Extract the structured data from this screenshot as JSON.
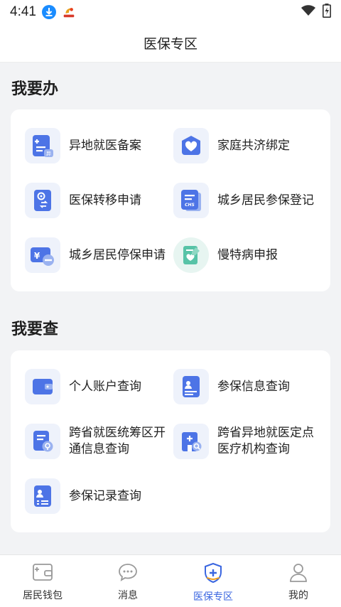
{
  "status_bar": {
    "time": "4:41"
  },
  "header": {
    "title": "医保专区"
  },
  "section_do": {
    "title": "我要办",
    "items": [
      {
        "label": "异地就医备案",
        "icon": "document-remote-icon"
      },
      {
        "label": "家庭共济绑定",
        "icon": "house-heart-icon"
      },
      {
        "label": "医保转移申请",
        "icon": "card-transfer-icon"
      },
      {
        "label": "城乡居民参保登记",
        "icon": "chs-card-icon"
      },
      {
        "label": "城乡居民停保申请",
        "icon": "yuan-minus-icon"
      },
      {
        "label": "慢特病申报",
        "icon": "heart-form-icon"
      }
    ]
  },
  "section_query": {
    "title": "我要查",
    "items": [
      {
        "label": "个人账户查询",
        "icon": "wallet-icon"
      },
      {
        "label": "参保信息查询",
        "icon": "id-card-icon"
      },
      {
        "label": "跨省就医统筹区开通信息查询",
        "icon": "document-location-icon"
      },
      {
        "label": "跨省异地就医定点医疗机构查询",
        "icon": "hospital-search-icon"
      },
      {
        "label": "参保记录查询",
        "icon": "record-list-icon"
      }
    ]
  },
  "tabbar": {
    "tabs": [
      {
        "label": "居民钱包",
        "icon": "wallet-tab-icon",
        "active": false
      },
      {
        "label": "消息",
        "icon": "chat-bubble-icon",
        "active": false
      },
      {
        "label": "医保专区",
        "icon": "medical-shield-icon",
        "active": true
      },
      {
        "label": "我的",
        "icon": "person-icon",
        "active": false
      }
    ]
  },
  "colors": {
    "accent": "#3a66e0",
    "icon_blue": "#4d74e6",
    "icon_green": "#57c3a7",
    "background": "#f2f3f5"
  }
}
